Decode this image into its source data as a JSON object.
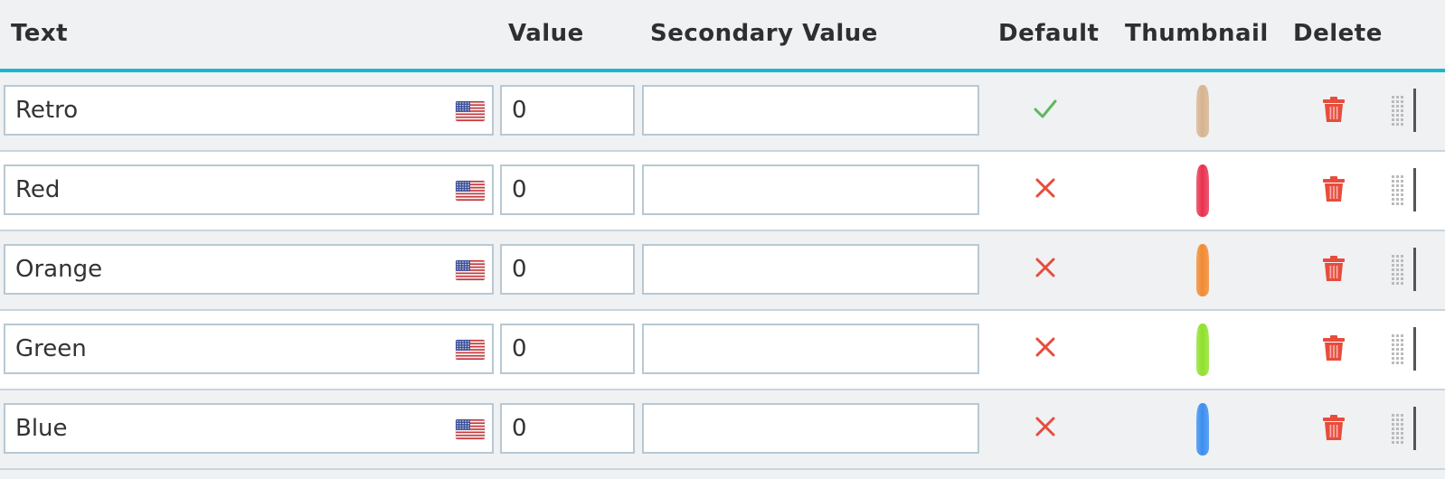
{
  "header": {
    "text": "Text",
    "value": "Value",
    "secondary_value": "Secondary Value",
    "default": "Default",
    "thumbnail": "Thumbnail",
    "delete": "Delete"
  },
  "colors": {
    "accent": "#1fb5cc",
    "check": "#5cb85c",
    "cross": "#e74c3c",
    "delete": "#e74c3c"
  },
  "rows": [
    {
      "text": "Retro",
      "value": "0",
      "secondary": "",
      "is_default": true,
      "flag_icon": "us-flag-icon",
      "thumbnail_color": "#d6b48f"
    },
    {
      "text": "Red",
      "value": "0",
      "secondary": "",
      "is_default": false,
      "flag_icon": "us-flag-icon",
      "thumbnail_color": "#e8304e"
    },
    {
      "text": "Orange",
      "value": "0",
      "secondary": "",
      "is_default": false,
      "flag_icon": "us-flag-icon",
      "thumbnail_color": "#f28a30"
    },
    {
      "text": "Green",
      "value": "0",
      "secondary": "",
      "is_default": false,
      "flag_icon": "us-flag-icon",
      "thumbnail_color": "#8fe02a"
    },
    {
      "text": "Blue",
      "value": "0",
      "secondary": "",
      "is_default": false,
      "flag_icon": "us-flag-icon",
      "thumbnail_color": "#3a8ef0"
    }
  ]
}
